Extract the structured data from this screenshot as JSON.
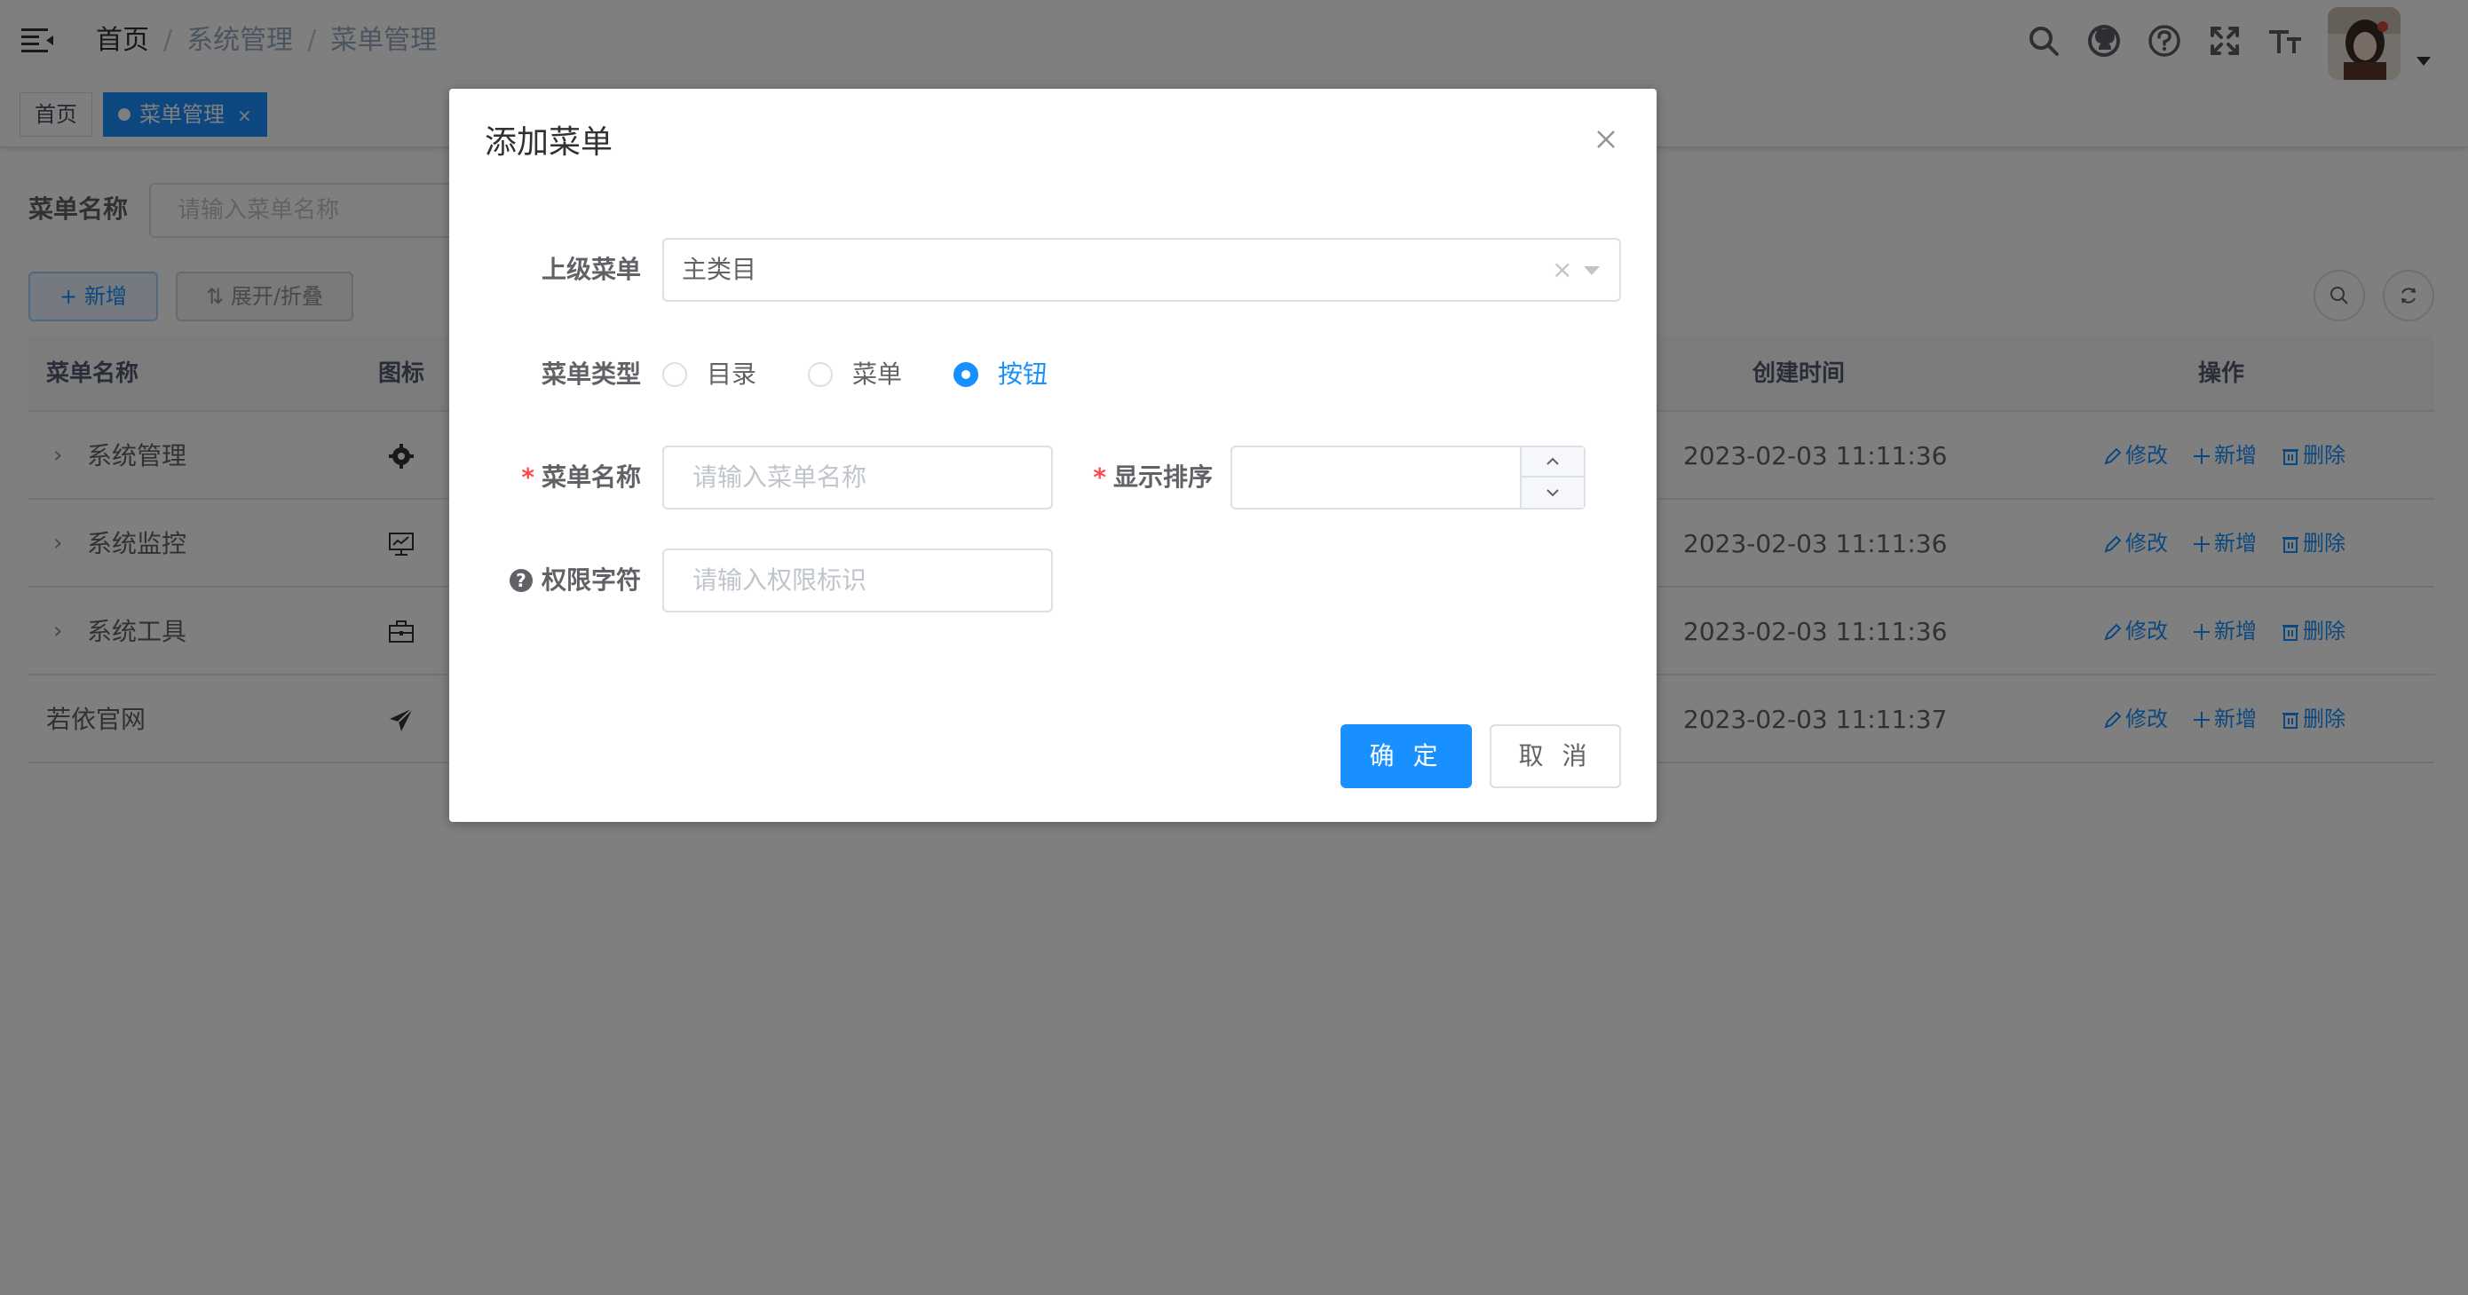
{
  "navbar": {
    "breadcrumb": [
      "首页",
      "系统管理",
      "菜单管理"
    ],
    "separator": "/",
    "icons": [
      "search-icon",
      "github-icon",
      "question-icon",
      "fullscreen-icon",
      "font-size-icon"
    ]
  },
  "tags": {
    "home": "首页",
    "active": "菜单管理",
    "close": "×"
  },
  "search": {
    "label": "菜单名称",
    "placeholder": "请输入菜单名称"
  },
  "toolbar": {
    "add_label": "+ 新增",
    "expand_label": "⇅ 展开/折叠"
  },
  "table": {
    "columns": {
      "name": "菜单名称",
      "icon": "图标",
      "created": "创建时间",
      "ops": "操作"
    },
    "rows": [
      {
        "arrow": "›",
        "name": "系统管理",
        "icon": "gear-icon",
        "created": "2023-02-03 11:11:36"
      },
      {
        "arrow": "›",
        "name": "系统监控",
        "icon": "monitor-icon",
        "created": "2023-02-03 11:11:36"
      },
      {
        "arrow": "›",
        "name": "系统工具",
        "icon": "toolbox-icon",
        "created": "2023-02-03 11:11:36"
      },
      {
        "arrow": "",
        "name": "若依官网",
        "icon": "send-icon",
        "created": "2023-02-03 11:11:37"
      }
    ],
    "op_edit": "修改",
    "op_add": "新增",
    "op_delete": "删除"
  },
  "dialog": {
    "title": "添加菜单",
    "parent_label": "上级菜单",
    "parent_value": "主类目",
    "parent_clear": "×",
    "type_label": "菜单类型",
    "type_options": [
      "目录",
      "菜单",
      "按钮"
    ],
    "type_selected": "按钮",
    "name_label": "菜单名称",
    "name_placeholder": "请输入菜单名称",
    "order_label": "显示排序",
    "perm_help": "?",
    "perm_label": "权限字符",
    "perm_placeholder": "请输入权限标识",
    "required_mark": "*",
    "confirm": "确 定",
    "cancel": "取 消"
  },
  "colors": {
    "primary": "#1890ff",
    "danger": "#ff4949",
    "overlay": "rgba(0,0,0,0.5)"
  }
}
